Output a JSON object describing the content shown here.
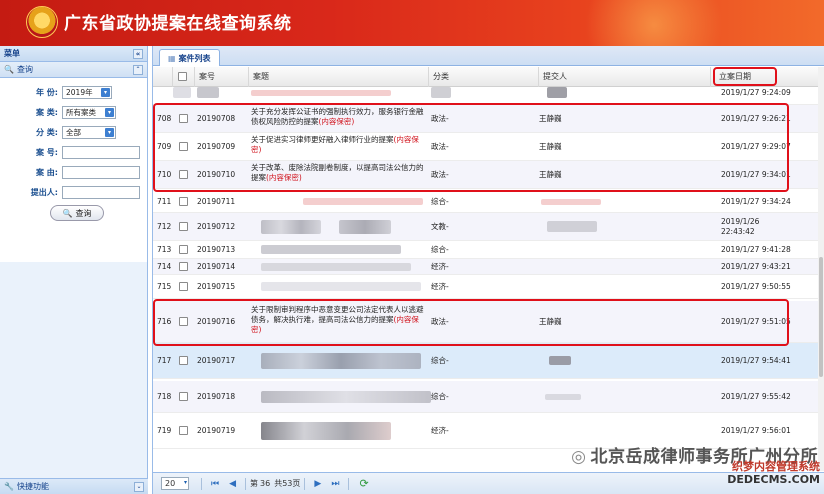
{
  "header": {
    "title": "广东省政协提案在线查询系统"
  },
  "sidebar": {
    "menu_title": "菜单",
    "collapse_glyph": "«",
    "query_title": "查询",
    "fields": [
      {
        "label": "年 份:",
        "value": "2019年",
        "type": "select"
      },
      {
        "label": "案 类:",
        "value": "所有案类",
        "type": "select"
      },
      {
        "label": "分 类:",
        "value": "全部",
        "type": "select"
      },
      {
        "label": "案 号:",
        "value": "",
        "type": "text"
      },
      {
        "label": "案 由:",
        "value": "",
        "type": "text"
      },
      {
        "label": "提出人:",
        "value": "",
        "type": "text"
      }
    ],
    "query_button": "查询",
    "quick_title": "快捷功能"
  },
  "main": {
    "tab_label": "案件列表",
    "columns": [
      "案号",
      "案题",
      "分类",
      "提交人",
      "立案日期"
    ],
    "rows": [
      {
        "num": "",
        "case_no": "",
        "title": "",
        "category": "",
        "submitter": "",
        "date": "2019/1/27 9:24:09",
        "blurred": true
      },
      {
        "num": "708",
        "case_no": "20190708",
        "title": "关于充分发挥公证书的强制执行效力，服务银行金融债权风险防控的提案",
        "secret": "(内容保密)",
        "category": "政法-",
        "submitter": "王静巍",
        "date": "2019/1/27 9:26:21"
      },
      {
        "num": "709",
        "case_no": "20190709",
        "title": "关于促进实习律师更好融入律师行业的提案",
        "secret": "(内容保密)",
        "category": "政法-",
        "submitter": "王静巍",
        "date": "2019/1/27 9:29:07"
      },
      {
        "num": "710",
        "case_no": "20190710",
        "title": "关于改革、废除法院副卷制度，以提高司法公信力的提案",
        "secret": "(内容保密)",
        "category": "政法-",
        "submitter": "王静巍",
        "date": "2019/1/27 9:34:01"
      },
      {
        "num": "711",
        "case_no": "20190711",
        "title": "",
        "category": "综合-",
        "submitter": "",
        "date": "2019/1/27 9:34:24",
        "blurred": true
      },
      {
        "num": "712",
        "case_no": "20190712",
        "title": "",
        "category": "文教-",
        "submitter": "",
        "date": "2019/1/26 22:43:42",
        "blurred": true
      },
      {
        "num": "713",
        "case_no": "20190713",
        "title": "",
        "category": "综合-",
        "submitter": "",
        "date": "2019/1/27 9:41:28",
        "blurred": true
      },
      {
        "num": "714",
        "case_no": "20190714",
        "title": "",
        "category": "经济-",
        "submitter": "",
        "date": "2019/1/27 9:43:21",
        "blurred": true
      },
      {
        "num": "715",
        "case_no": "20190715",
        "title": "",
        "category": "经济-",
        "submitter": "",
        "date": "2019/1/27 9:50:55",
        "blurred": true
      },
      {
        "num": "716",
        "case_no": "20190716",
        "title": "关于限制审判程序中恶意变更公司法定代表人以逃避债务，解决执行难，提高司法公信力的提案",
        "secret": "(内容保密)",
        "category": "政法-",
        "submitter": "王静巍",
        "date": "2019/1/27 9:51:05"
      },
      {
        "num": "717",
        "case_no": "20190717",
        "title": "",
        "category": "综合-",
        "submitter": "",
        "date": "2019/1/27 9:54:41",
        "blurred": true
      },
      {
        "num": "718",
        "case_no": "20190718",
        "title": "",
        "category": "综合-",
        "submitter": "",
        "date": "2019/1/27 9:55:42",
        "blurred": true
      },
      {
        "num": "719",
        "case_no": "20190719",
        "title": "",
        "category": "经济-",
        "submitter": "",
        "date": "2019/1/27 9:56:01",
        "blurred": true
      }
    ],
    "pager": {
      "page_size": "20",
      "page_prefix": "第",
      "page_value": "36",
      "page_suffix": "共53页"
    }
  },
  "watermark": {
    "text": "北京岳成律师事务所广州分所",
    "site_name": "织梦内容管理系统",
    "site_url": "DEDECMS.COM"
  }
}
